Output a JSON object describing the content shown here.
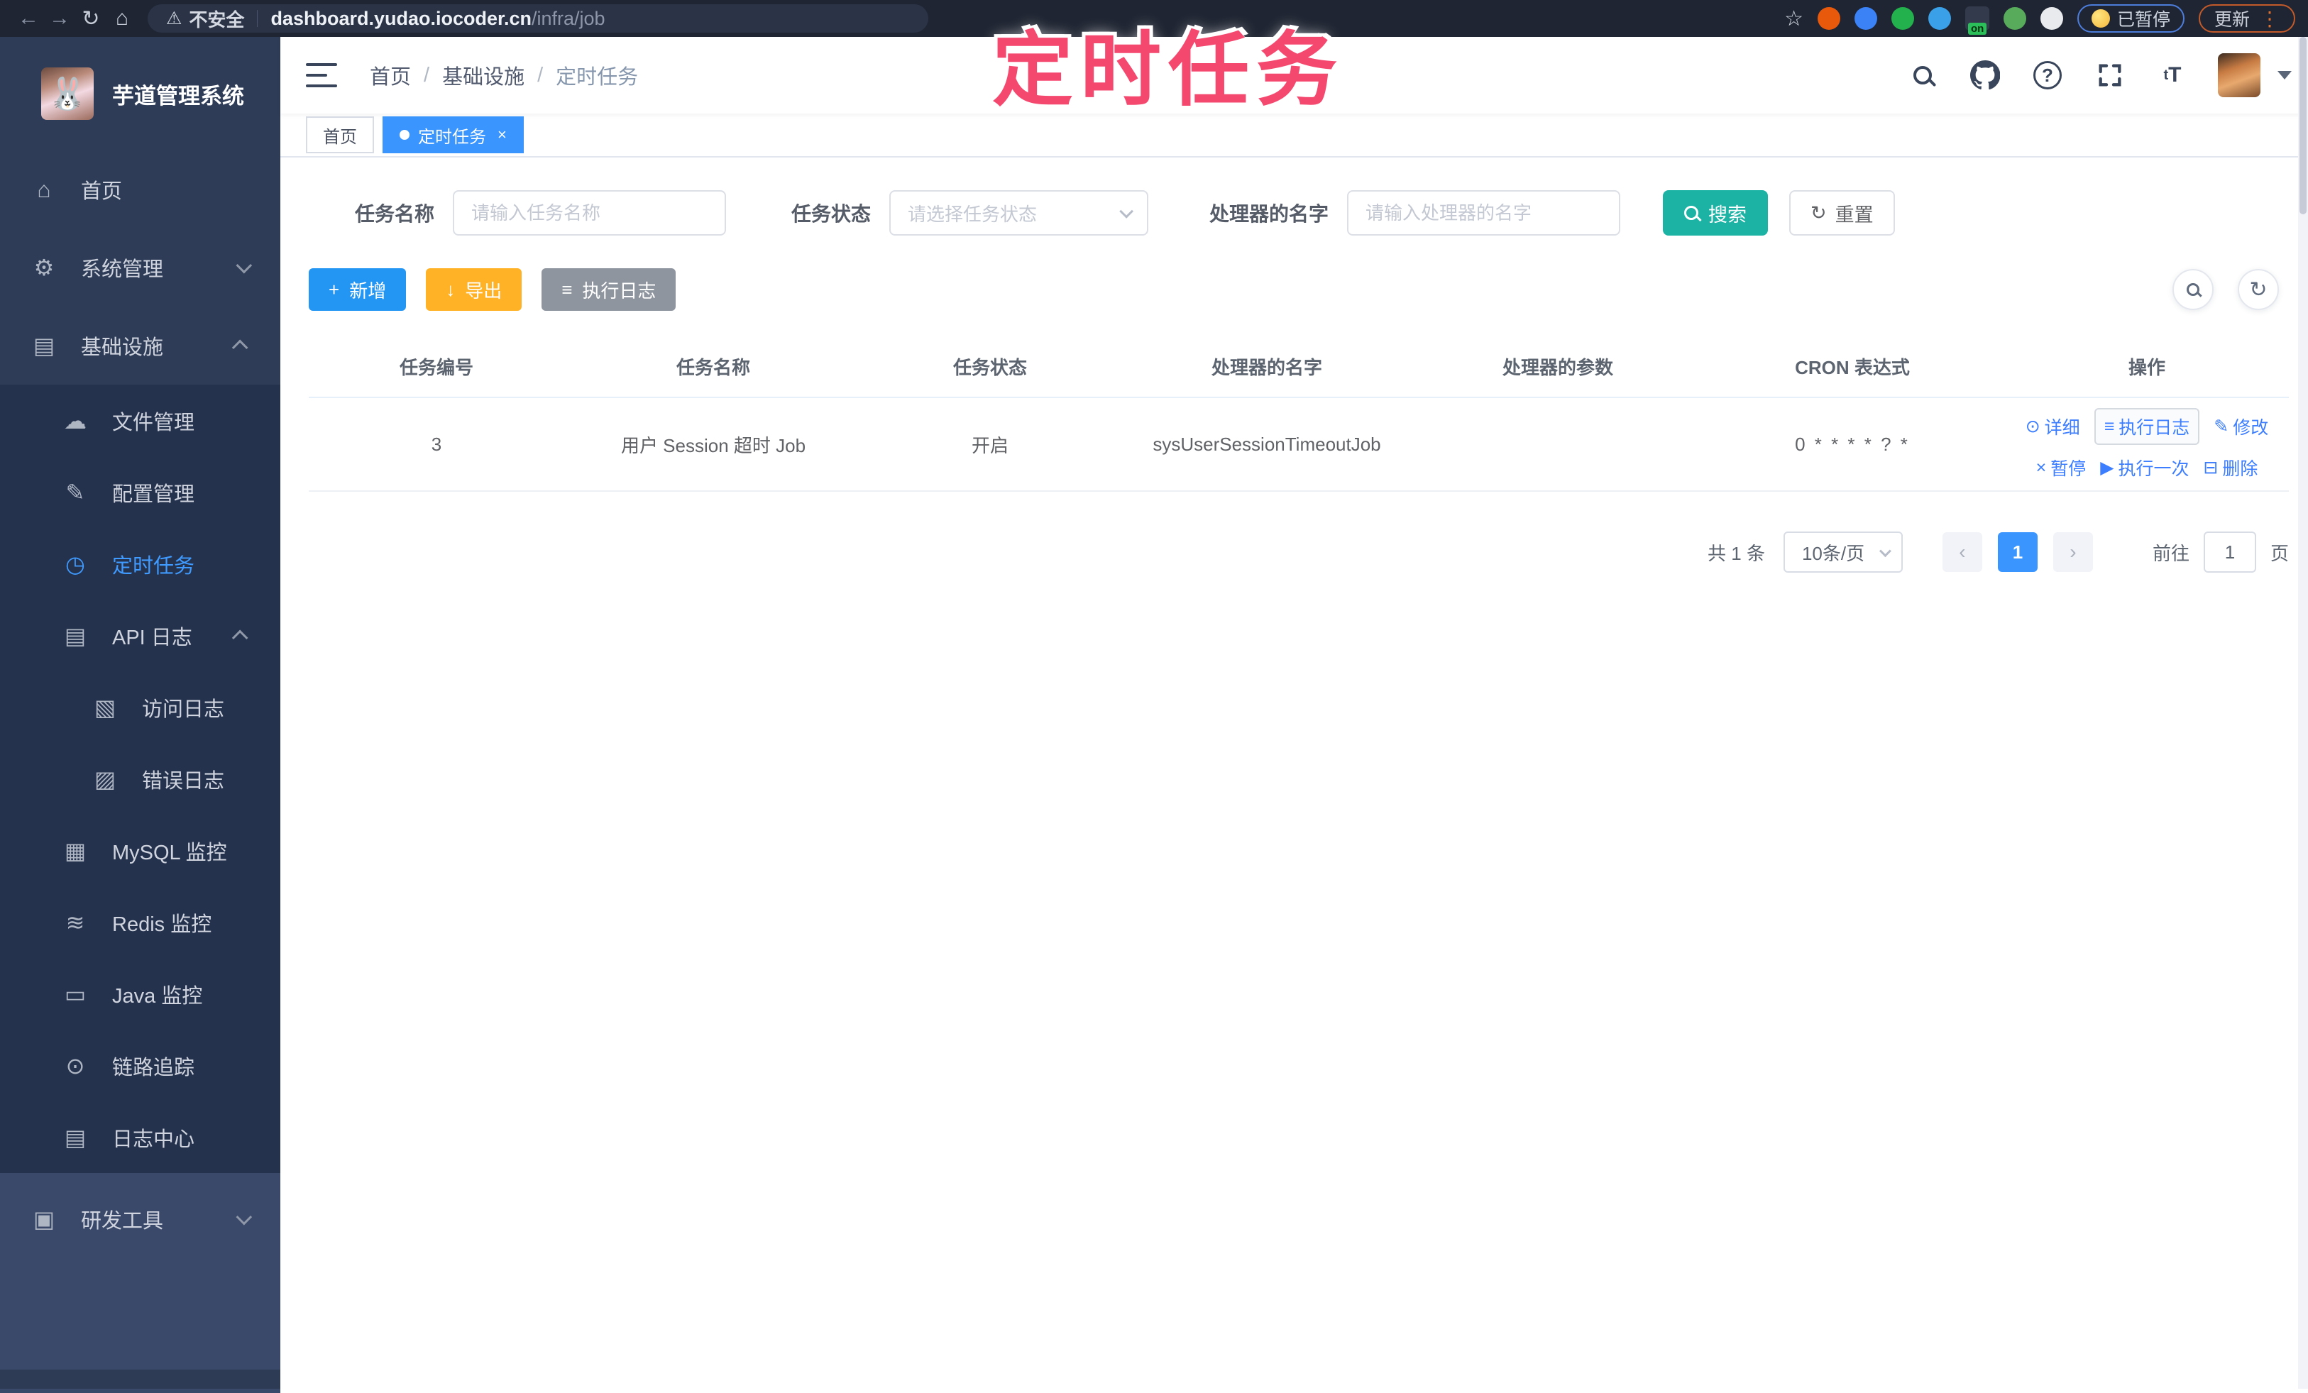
{
  "colors": {
    "accent_blue": "#3a96fe",
    "link_blue": "#3d7eff",
    "teal_search": "#1cb3a4",
    "amber_export": "#ffb226",
    "gray_log": "#8f959e",
    "annotation_pink": "#f5486f",
    "sidebar_bg": "#2e3c57",
    "submenu_bg": "#25324e",
    "browser_bg": "#1f2532"
  },
  "browser": {
    "back_icon": "←",
    "forward_icon": "→",
    "reload_icon": "↻",
    "home_icon": "⌂",
    "warning_icon": "⚠",
    "security_label": "不安全",
    "url_host": "dashboard.yudao.iocoder.cn",
    "url_path": "/infra/job",
    "bookmark_icon": "☆",
    "ext_on_badge": "on",
    "paused_badge": "已暂停",
    "update_button": "更新",
    "menu_icon": "⋮"
  },
  "annotation": {
    "text": "定时任务"
  },
  "sidebar": {
    "app_title": "芋道管理系统",
    "items": [
      {
        "label": "首页",
        "glyph": "⌂"
      },
      {
        "label": "系统管理",
        "glyph": "⚙"
      },
      {
        "label": "基础设施",
        "glyph": "▤"
      },
      {
        "label": "文件管理",
        "glyph": "☁"
      },
      {
        "label": "配置管理",
        "glyph": "✎"
      },
      {
        "label": "定时任务",
        "glyph": "◷"
      },
      {
        "label": "API 日志",
        "glyph": "▤"
      },
      {
        "label": "访问日志",
        "glyph": "▧"
      },
      {
        "label": "错误日志",
        "glyph": "▨"
      },
      {
        "label": "MySQL 监控",
        "glyph": "▦"
      },
      {
        "label": "Redis 监控",
        "glyph": "≋"
      },
      {
        "label": "Java 监控",
        "glyph": "▭"
      },
      {
        "label": "链路追踪",
        "glyph": "⊙"
      },
      {
        "label": "日志中心",
        "glyph": "▤"
      },
      {
        "label": "研发工具",
        "glyph": "▣"
      }
    ]
  },
  "header": {
    "breadcrumb": {
      "home": "首页",
      "section": "基础设施",
      "current": "定时任务",
      "separator": "/"
    },
    "fontsize_icon_text": "tT",
    "question_mark": "?"
  },
  "tabs": {
    "home": {
      "label": "首页"
    },
    "current": {
      "label": "定时任务",
      "close_icon": "×"
    }
  },
  "filters": {
    "name_label": "任务名称",
    "name_placeholder": "请输入任务名称",
    "status_label": "任务状态",
    "status_placeholder": "请选择任务状态",
    "handler_label": "处理器的名字",
    "handler_placeholder": "请输入处理器的名字",
    "search_label": "搜索",
    "reset_label": "重置",
    "reset_icon": "↻"
  },
  "toolbar": {
    "add_label": "新增",
    "add_icon": "+",
    "export_label": "导出",
    "export_icon": "↓",
    "log_label": "执行日志",
    "log_icon": "≡",
    "refresh_icon": "↻"
  },
  "table": {
    "headers": [
      "任务编号",
      "任务名称",
      "任务状态",
      "处理器的名字",
      "处理器的参数",
      "CRON 表达式",
      "操作"
    ],
    "row": {
      "id": "3",
      "name": "用户 Session 超时 Job",
      "status": "开启",
      "handler": "sysUserSessionTimeoutJob",
      "param": "",
      "cron": "0 * * * * ? *"
    },
    "ops": [
      {
        "glyph": "⊙",
        "label": "详细"
      },
      {
        "glyph": "≡",
        "label": "执行日志"
      },
      {
        "glyph": "✎",
        "label": "修改"
      },
      {
        "glyph": "×",
        "label": "暂停"
      },
      {
        "glyph": "▶",
        "label": "执行一次"
      },
      {
        "glyph": "⊟",
        "label": "删除"
      }
    ]
  },
  "pagination": {
    "total": "共 1 条",
    "page_size": "10条/页",
    "prev_icon": "‹",
    "next_icon": "›",
    "current_page": "1",
    "goto_label": "前往",
    "goto_value": "1",
    "page_label": "页"
  }
}
